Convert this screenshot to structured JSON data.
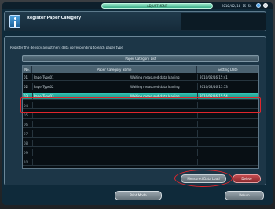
{
  "status_bar": {
    "pill_text": "ADJUSTMENT",
    "datetime": "2010/02/16 15:56"
  },
  "header": {
    "title": "Register Paper Category"
  },
  "instruction": "Register the density adjustment data corresponding to each paper type",
  "list": {
    "title": "Paper Category List",
    "columns": {
      "no": "No.",
      "name": "Paper Category Name",
      "date": "Setting Date"
    },
    "rows": [
      {
        "no": "01",
        "name": "PaperType01",
        "status": "Waiting measured data loading",
        "date": "2010/02/16 15:41"
      },
      {
        "no": "02",
        "name": "PaperType02",
        "status": "Waiting measured data loading",
        "date": "2010/02/16 15:53"
      },
      {
        "no": "03",
        "name": "PaperType03",
        "status": "Waiting measured data loading",
        "date": "2010/02/16 15:54"
      },
      {
        "no": "04",
        "name": "",
        "status": "",
        "date": ""
      },
      {
        "no": "05",
        "name": "",
        "status": "",
        "date": ""
      },
      {
        "no": "06",
        "name": "",
        "status": "",
        "date": ""
      },
      {
        "no": "07",
        "name": "",
        "status": "",
        "date": ""
      },
      {
        "no": "08",
        "name": "",
        "status": "",
        "date": ""
      },
      {
        "no": "09",
        "name": "",
        "status": "",
        "date": ""
      },
      {
        "no": "10",
        "name": "",
        "status": "",
        "date": ""
      }
    ]
  },
  "buttons": {
    "register": "Measured Data Load",
    "delete": "Delete",
    "print": "Print Mode",
    "return": "Return"
  },
  "colors": {
    "selected_row": "#35c4b4",
    "highlight": "#e0262c",
    "status_pill": "#6fd2ad"
  }
}
